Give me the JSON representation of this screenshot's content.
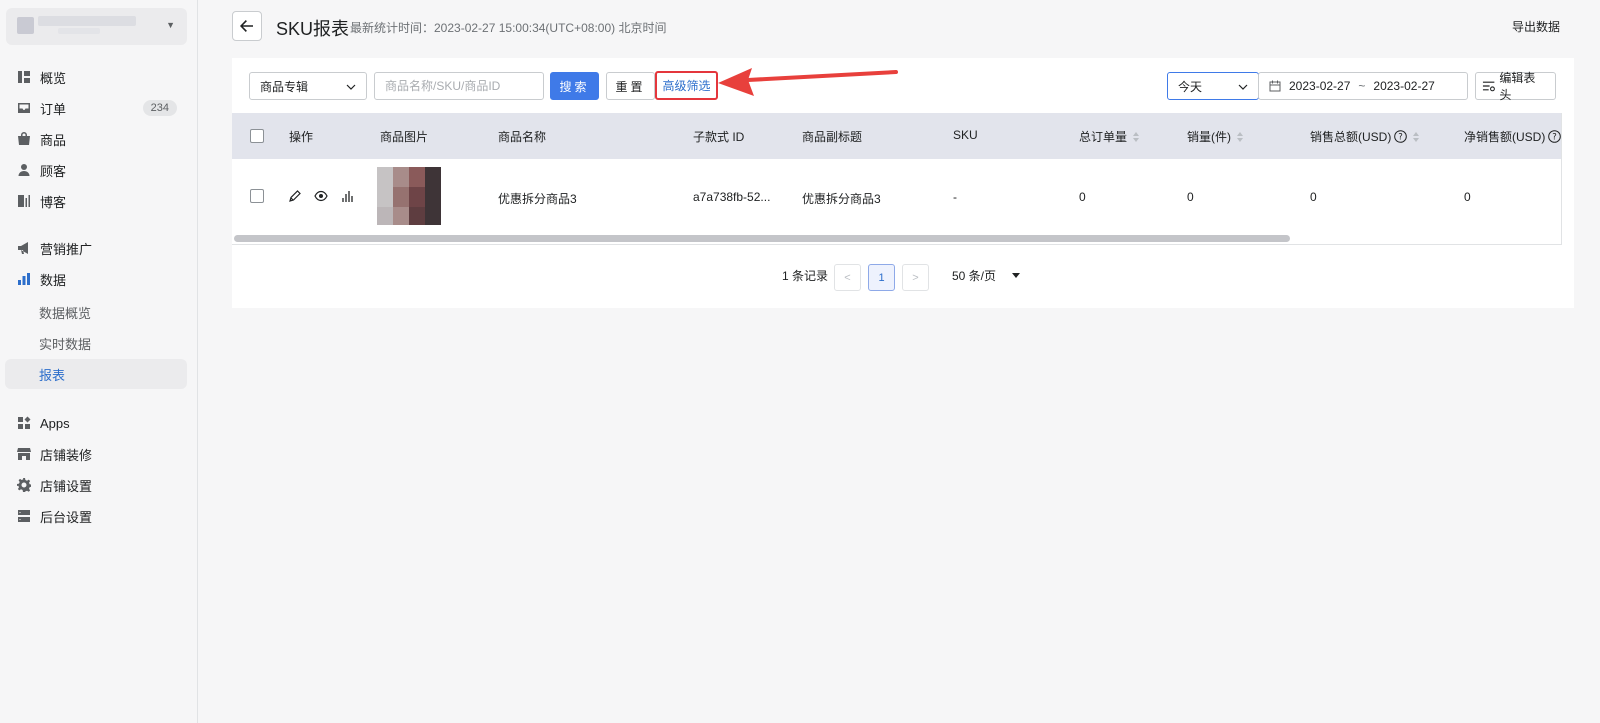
{
  "sidebar": {
    "items": [
      {
        "label": "概览",
        "icon": "overview-icon"
      },
      {
        "label": "订单",
        "icon": "inbox-icon",
        "badge": "234"
      },
      {
        "label": "商品",
        "icon": "bag-icon"
      },
      {
        "label": "顾客",
        "icon": "person-icon"
      },
      {
        "label": "博客",
        "icon": "blog-icon"
      },
      {
        "label": "营销推广",
        "icon": "megaphone-icon"
      },
      {
        "label": "数据",
        "icon": "bar-chart-icon"
      },
      {
        "label": "Apps",
        "icon": "apps-icon"
      },
      {
        "label": "店铺装修",
        "icon": "store-icon"
      },
      {
        "label": "店铺设置",
        "icon": "gear-icon"
      },
      {
        "label": "后台设置",
        "icon": "server-icon"
      }
    ],
    "data_sub": [
      "数据概览",
      "实时数据",
      "报表"
    ]
  },
  "header": {
    "title": "SKU报表",
    "stat_time": "最新统计时间：2023-02-27 15:00:34(UTC+08:00) 北京时间",
    "export_label": "导出数据"
  },
  "filters": {
    "collection_select": "商品专辑",
    "search_placeholder": "商品名称/SKU/商品ID",
    "search_label": "搜索",
    "reset_label": "重置",
    "advanced_label": "高级筛选",
    "date_preset": "今天",
    "date_start": "2023-02-27",
    "date_sep": "~",
    "date_end": "2023-02-27",
    "edit_columns_label": "编辑表头"
  },
  "table": {
    "columns": [
      "操作",
      "商品图片",
      "商品名称",
      "子款式 ID",
      "商品副标题",
      "SKU",
      "总订单量",
      "销量(件)",
      "销售总额(USD)",
      "净销售额(USD)"
    ],
    "rows": [
      {
        "name": "优惠拆分商品3",
        "variant_id": "a7a738fb-52...",
        "subtitle": "优惠拆分商品3",
        "sku": "-",
        "orders": "0",
        "qty": "0",
        "gross": "0",
        "net": "0"
      }
    ]
  },
  "pagination": {
    "total": "1 条记录",
    "current_page": "1",
    "page_size": "50 条/页"
  },
  "colors": {
    "primary": "#3f7ae8",
    "link": "#2c6ecb",
    "highlight": "#e4363c"
  }
}
